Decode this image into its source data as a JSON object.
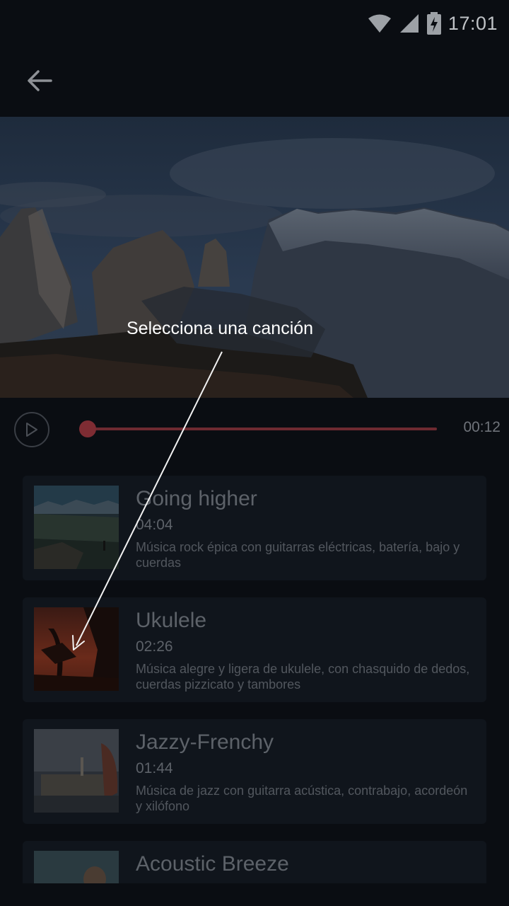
{
  "status_bar": {
    "time": "17:01",
    "icons": [
      "wifi-icon",
      "signal-icon",
      "battery-charging-icon"
    ]
  },
  "app_bar": {
    "back_icon": "arrow-back-icon"
  },
  "player": {
    "play_icon": "play-icon",
    "elapsed": "00:12",
    "progress": 0.02,
    "accent_color": "#c0303c"
  },
  "tutorial": {
    "text": "Selecciona una canción"
  },
  "songs": [
    {
      "title": "Going higher",
      "duration": "04:04",
      "description": "Música rock épica con guitarras eléctricas, batería, bajo y cuerdas"
    },
    {
      "title": "Ukulele",
      "duration": "02:26",
      "description": "Música alegre y ligera de ukulele, con chasquido de dedos, cuerdas pizzicato y tambores"
    },
    {
      "title": "Jazzy-Frenchy",
      "duration": "01:44",
      "description": "Música de jazz con guitarra acústica, contrabajo, acordeón y xilófono"
    },
    {
      "title": "Acoustic Breeze",
      "duration": "",
      "description": ""
    }
  ]
}
